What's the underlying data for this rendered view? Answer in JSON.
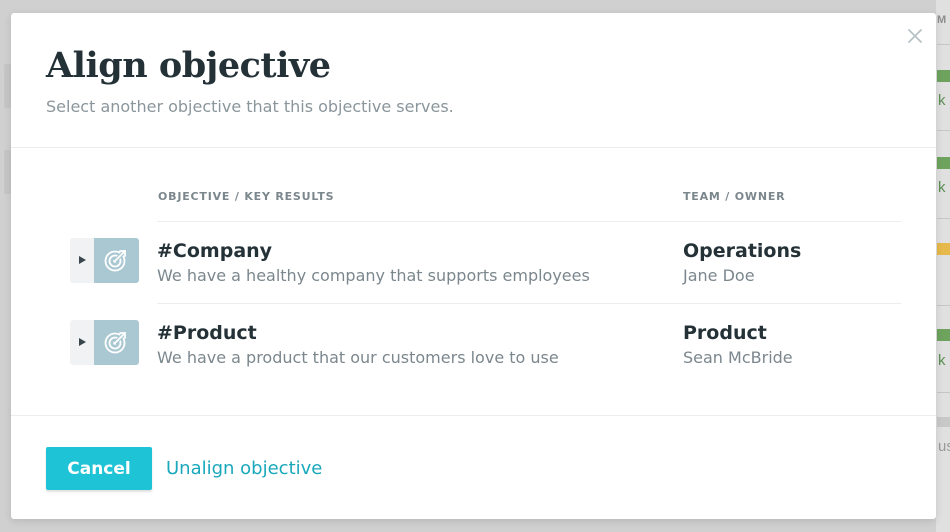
{
  "background": {
    "column_header_fragment": "M",
    "row_fragments": [
      "k",
      "k",
      "k"
    ],
    "footer_fragment": "us"
  },
  "modal": {
    "title": "Align objective",
    "subtitle": "Select another objective that this objective serves.",
    "close_icon": "close-icon",
    "columns": {
      "objective": "OBJECTIVE / KEY RESULTS",
      "team": "TEAM / OWNER"
    },
    "rows": [
      {
        "title": "#Company",
        "description": "We have a healthy company that supports employees",
        "team": "Operations",
        "owner": "Jane Doe",
        "icon": "target-icon"
      },
      {
        "title": "#Product",
        "description": "We have a product that our customers love to use",
        "team": "Product",
        "owner": "Sean McBride",
        "icon": "target-icon"
      }
    ],
    "footer": {
      "cancel_label": "Cancel",
      "unalign_label": "Unalign objective"
    }
  },
  "colors": {
    "accent": "#1fc3d6",
    "link": "#1aa8bc",
    "icon_bg": "#aac8d2",
    "heading": "#243238",
    "muted": "#7b878d"
  }
}
